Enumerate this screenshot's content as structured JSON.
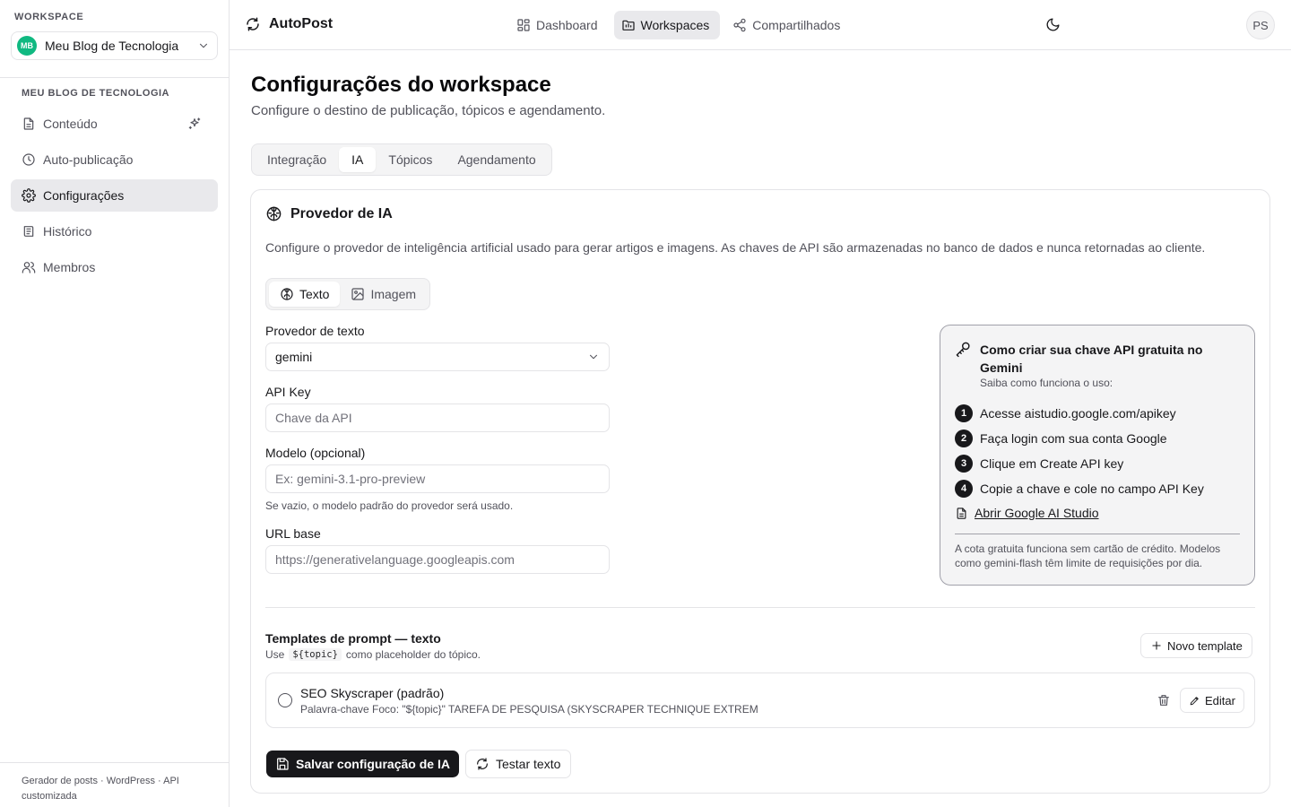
{
  "sidebar": {
    "workspace_label": "WORKSPACE",
    "workspace": {
      "initials": "MB",
      "name": "Meu Blog de Tecnologia",
      "avatar_color": "#10b981"
    },
    "section_label": "MEU BLOG DE TECNOLOGIA",
    "items": [
      {
        "label": "Conteúdo",
        "icon": "file-text-icon"
      },
      {
        "label": "Auto-publicação",
        "icon": "clock-icon"
      },
      {
        "label": "Configurações",
        "icon": "gear-icon",
        "active": true
      },
      {
        "label": "Histórico",
        "icon": "history-icon"
      },
      {
        "label": "Membros",
        "icon": "users-icon"
      }
    ],
    "footer": "Gerador de posts · WordPress · API customizada"
  },
  "topbar": {
    "brand": "AutoPost",
    "nav": [
      {
        "label": "Dashboard",
        "icon": "grid-icon"
      },
      {
        "label": "Workspaces",
        "icon": "folder-icon",
        "active": true
      },
      {
        "label": "Compartilhados",
        "icon": "share-icon"
      }
    ],
    "user_initials": "PS"
  },
  "page": {
    "title": "Configurações do workspace",
    "subtitle": "Configure o destino de publicação, tópicos e agendamento.",
    "tabs": [
      "Integração",
      "IA",
      "Tópicos",
      "Agendamento"
    ],
    "active_tab": "IA"
  },
  "card": {
    "title": "Provedor de IA",
    "description": "Configure o provedor de inteligência artificial usado para gerar artigos e imagens. As chaves de API são armazenadas no banco de dados e nunca retornadas ao cliente.",
    "subtabs": [
      "Texto",
      "Imagem"
    ],
    "form": {
      "provider_label": "Provedor de texto",
      "provider_value": "gemini",
      "api_key_label": "API Key",
      "api_key_placeholder": "Chave da API",
      "model_label": "Modelo (opcional)",
      "model_placeholder": "Ex: gemini-3.1-pro-preview",
      "model_hint": "Se vazio, o modelo padrão do provedor será usado.",
      "base_url_label": "URL base",
      "base_url_placeholder": "https://generativelanguage.googleapis.com"
    },
    "help": {
      "title": "Como criar sua chave API gratuita no Gemini",
      "subtitle": "Saiba como funciona o uso:",
      "steps": [
        {
          "num": "1",
          "text": "Acesse aistudio.google.com/apikey"
        },
        {
          "num": "2",
          "text": "Faça login com sua conta Google"
        },
        {
          "num": "3",
          "text": "Clique em Create API key"
        },
        {
          "num": "4",
          "text": "Copie a chave e cole no campo API Key"
        }
      ],
      "link": "Abrir Google AI Studio",
      "note": "A cota gratuita funciona sem cartão de crédito. Modelos como gemini-flash têm limite de requisições por dia."
    },
    "templates": {
      "title": "Templates de prompt — texto",
      "hint_before": "Use",
      "hint_code": "${topic}",
      "hint_after": "como placeholder do tópico.",
      "new_button": "Novo template",
      "items": [
        {
          "name": "SEO Skyscraper (padrão)",
          "preview": "Palavra-chave Foco: \"${topic}\" TAREFA DE PESQUISA (SKYSCRAPER TECHNIQUE EXTREM",
          "edit_label": "Editar"
        }
      ]
    },
    "save_button": "Salvar configuração de IA",
    "test_button": "Testar texto"
  }
}
